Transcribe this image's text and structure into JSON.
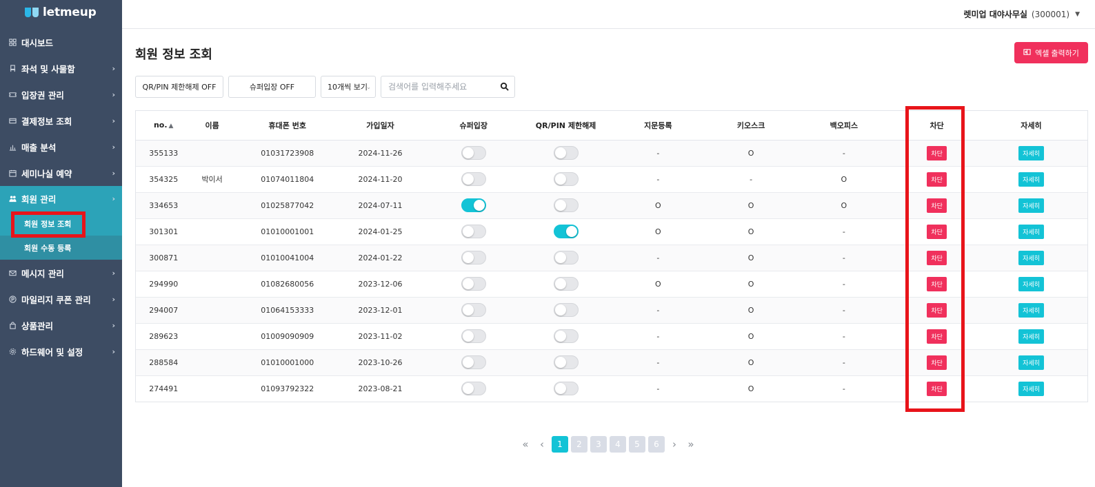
{
  "brand": {
    "name": "letmeup"
  },
  "sidebar": {
    "items": [
      {
        "label": "대시보드",
        "icon": "grid-icon",
        "chevron": false
      },
      {
        "label": "좌석 및 사물함",
        "icon": "seat-icon",
        "chevron": true
      },
      {
        "label": "입장권 관리",
        "icon": "ticket-icon",
        "chevron": true
      },
      {
        "label": "결제정보 조회",
        "icon": "card-icon",
        "chevron": true
      },
      {
        "label": "매출 분석",
        "icon": "bar-chart-icon",
        "chevron": true
      },
      {
        "label": "세미나실 예약",
        "icon": "calendar-icon",
        "chevron": true
      },
      {
        "label": "회원 관리",
        "icon": "users-icon",
        "chevron": true
      },
      {
        "label": "메시지 관리",
        "icon": "mail-icon",
        "chevron": true
      },
      {
        "label": "마일리지 쿠폰 관리",
        "icon": "point-icon",
        "chevron": true
      },
      {
        "label": "상품관리",
        "icon": "bag-icon",
        "chevron": true
      },
      {
        "label": "하드웨어 및 설정",
        "icon": "gear-icon",
        "chevron": true
      }
    ],
    "submenu": [
      {
        "label": "회원 정보 조회"
      },
      {
        "label": "회원 수동 등록"
      }
    ]
  },
  "topbar": {
    "org_name": "렛미업 대야사무실",
    "org_code": "(300001)"
  },
  "page": {
    "title": "회원 정보 조회",
    "excel_label": "엑셀 출력하기",
    "qr_filter_label": "QR/PIN 제한해제 OFF",
    "super_filter_label": "슈퍼입장 OFF",
    "page_size_label": "10개씩 보기",
    "search_placeholder": "검색어를 입력해주세요"
  },
  "table": {
    "headers": {
      "no": "no.",
      "name": "이름",
      "phone": "휴대폰 번호",
      "joined": "가입일자",
      "super": "슈퍼입장",
      "qr": "QR/PIN 제한해제",
      "finger": "지문등록",
      "kiosk": "키오스크",
      "backoffice": "백오피스",
      "block": "차단",
      "detail": "자세히"
    },
    "block_label": "차단",
    "detail_label": "자세히",
    "rows": [
      {
        "no": "355133",
        "name": "",
        "phone": "01031723908",
        "joined": "2024-11-26",
        "super_on": false,
        "qr_on": false,
        "finger": "-",
        "kiosk": "O",
        "backoffice": "-"
      },
      {
        "no": "354325",
        "name": "박이서",
        "phone": "01074011804",
        "joined": "2024-11-20",
        "super_on": false,
        "qr_on": false,
        "finger": "-",
        "kiosk": "-",
        "backoffice": "O"
      },
      {
        "no": "334653",
        "name": "",
        "phone": "01025877042",
        "joined": "2024-07-11",
        "super_on": true,
        "qr_on": false,
        "finger": "O",
        "kiosk": "O",
        "backoffice": "O"
      },
      {
        "no": "301301",
        "name": "",
        "phone": "01010001001",
        "joined": "2024-01-25",
        "super_on": false,
        "qr_on": true,
        "finger": "O",
        "kiosk": "O",
        "backoffice": "-"
      },
      {
        "no": "300871",
        "name": "",
        "phone": "01010041004",
        "joined": "2024-01-22",
        "super_on": false,
        "qr_on": false,
        "finger": "-",
        "kiosk": "O",
        "backoffice": "-"
      },
      {
        "no": "294990",
        "name": "",
        "phone": "01082680056",
        "joined": "2023-12-06",
        "super_on": false,
        "qr_on": false,
        "finger": "O",
        "kiosk": "O",
        "backoffice": "-"
      },
      {
        "no": "294007",
        "name": "",
        "phone": "01064153333",
        "joined": "2023-12-01",
        "super_on": false,
        "qr_on": false,
        "finger": "-",
        "kiosk": "O",
        "backoffice": "-"
      },
      {
        "no": "289623",
        "name": "",
        "phone": "01009090909",
        "joined": "2023-11-02",
        "super_on": false,
        "qr_on": false,
        "finger": "-",
        "kiosk": "O",
        "backoffice": "-"
      },
      {
        "no": "288584",
        "name": "",
        "phone": "01010001000",
        "joined": "2023-10-26",
        "super_on": false,
        "qr_on": false,
        "finger": "-",
        "kiosk": "O",
        "backoffice": "-"
      },
      {
        "no": "274491",
        "name": "",
        "phone": "01093792322",
        "joined": "2023-08-21",
        "super_on": false,
        "qr_on": false,
        "finger": "-",
        "kiosk": "O",
        "backoffice": "-"
      }
    ]
  },
  "pagination": {
    "pages": [
      "1",
      "2",
      "3",
      "4",
      "5",
      "6"
    ],
    "current": "1"
  },
  "colors": {
    "sidebar_bg": "#3d4c63",
    "accent_teal": "#13c3d6",
    "accent_pink": "#f0305c",
    "highlight_red": "#e8141a"
  }
}
